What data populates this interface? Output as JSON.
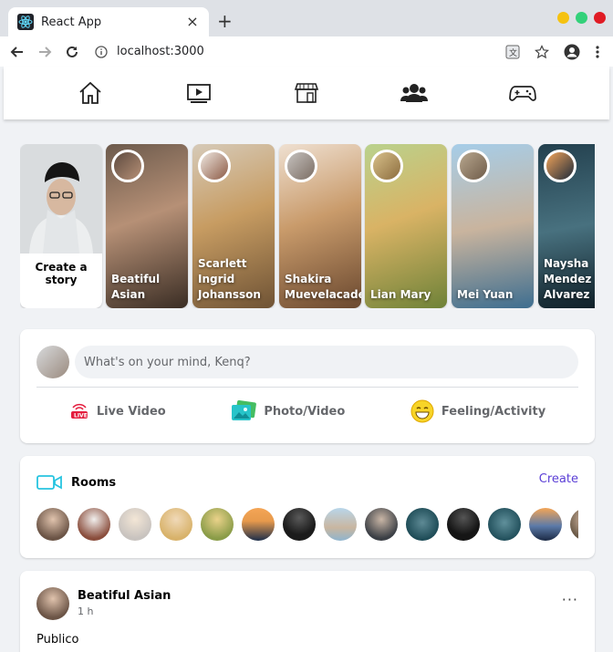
{
  "browser": {
    "tab_title": "React App",
    "tab_close": "×",
    "new_tab": "+",
    "url": "localhost:3000",
    "traffic": [
      "#f5c211",
      "#33d17a",
      "#e01b24"
    ]
  },
  "header": {
    "icons": [
      "home-icon",
      "watch-icon",
      "marketplace-icon",
      "groups-icon",
      "gaming-icon"
    ]
  },
  "stories": {
    "create_label": "Create a story",
    "items": [
      {
        "name": "Beatiful Asian",
        "bg": [
          "#5d4a3f",
          "#a78670",
          "#2f2620"
        ]
      },
      {
        "name": "Scarlett Ingrid Johansson",
        "bg": [
          "#cfc1ae",
          "#c49a66",
          "#7e6243"
        ]
      },
      {
        "name": "Shakira Muevelacaderas",
        "bg": [
          "#ead6c4",
          "#c89b6b",
          "#6f4d34"
        ]
      },
      {
        "name": "Lian Mary",
        "bg": [
          "#b4d18a",
          "#d7b060",
          "#7d8f3e"
        ]
      },
      {
        "name": "Mei Yuan",
        "bg": [
          "#9ac3e0",
          "#c7b4a0",
          "#3d6c8e"
        ]
      },
      {
        "name": "Naysha Mendez Alvarez",
        "bg": [
          "#1e3b49",
          "#3f6a78",
          "#0f1f28"
        ]
      }
    ]
  },
  "composer": {
    "placeholder": "What's on your mind, Kenq?",
    "actions": [
      "Live Video",
      "Photo/Video",
      "Feeling/Activity"
    ]
  },
  "rooms": {
    "title": "Rooms",
    "create_label": "Create",
    "avatars": [
      "#6b5446",
      "#8a4d3c",
      "#c8c3bf",
      "#d8b26a",
      "#c9a451",
      "#e79a4c",
      "#1b1b1b",
      "#8fb5cf",
      "#3b3f45",
      "#1d4b56",
      "#151515",
      "#22505c",
      "#5c7aa8",
      "#6b5a47"
    ]
  },
  "post": {
    "author": "Beatiful Asian",
    "time": "1 h",
    "text": "Publico",
    "more": "···"
  }
}
